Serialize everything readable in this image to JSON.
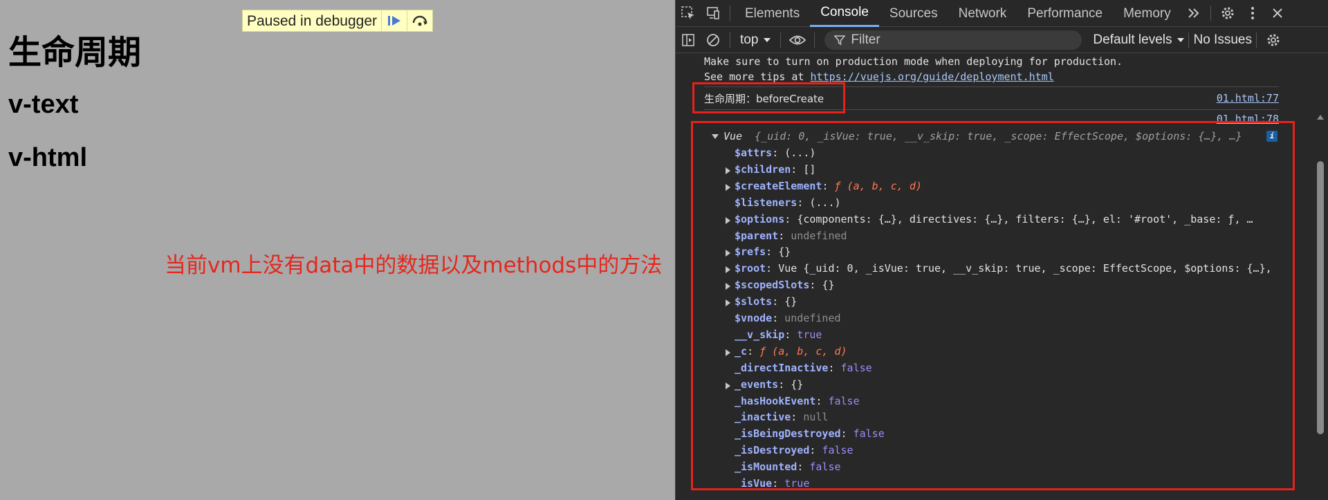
{
  "page": {
    "heading1": "生命周期",
    "heading2": "v-text",
    "heading3": "v-html",
    "debugger_banner": "Paused in debugger",
    "annotation": "当前vm上没有data中的数据以及methods中的方法"
  },
  "devtools": {
    "tabs": [
      "Elements",
      "Console",
      "Sources",
      "Network",
      "Performance",
      "Memory"
    ],
    "active_tab": "Console",
    "toolbar": {
      "context": "top",
      "filter_placeholder": "Filter",
      "levels": "Default levels",
      "issues": "No Issues"
    },
    "console": {
      "tip_line1": "Make sure to turn on production mode when deploying for production.",
      "tip_line2_prefix": "See more tips at ",
      "tip_link": "https://vuejs.org/guide/deployment.html",
      "log_text": "生命周期：beforeCreate",
      "log_source": "01.html:77",
      "log2_source": "01.html:78",
      "vue_summary_name": "Vue",
      "vue_summary": "{_uid: 0, _isVue: true, __v_skip: true, _scope: EffectScope, $options: {…}, …}",
      "props": [
        {
          "name": "$attrs",
          "value": "(...)",
          "kind": "val",
          "expandable": false
        },
        {
          "name": "$children",
          "value": "[]",
          "kind": "val",
          "expandable": true
        },
        {
          "name": "$createElement",
          "value": "ƒ (a, b, c, d)",
          "kind": "fn",
          "expandable": true
        },
        {
          "name": "$listeners",
          "value": "(...)",
          "kind": "val",
          "expandable": false
        },
        {
          "name": "$options",
          "value": "{components: {…}, directives: {…}, filters: {…}, el: '#root', _base: ƒ, …",
          "kind": "val",
          "expandable": true
        },
        {
          "name": "$parent",
          "value": "undefined",
          "kind": "null",
          "expandable": false
        },
        {
          "name": "$refs",
          "value": "{}",
          "kind": "val",
          "expandable": true
        },
        {
          "name": "$root",
          "value": "Vue  {_uid: 0, _isVue: true, __v_skip: true, _scope: EffectScope, $options: {…},",
          "kind": "val",
          "expandable": true
        },
        {
          "name": "$scopedSlots",
          "value": "{}",
          "kind": "val",
          "expandable": true
        },
        {
          "name": "$slots",
          "value": "{}",
          "kind": "val",
          "expandable": true
        },
        {
          "name": "$vnode",
          "value": "undefined",
          "kind": "null",
          "expandable": false
        },
        {
          "name": "__v_skip",
          "value": "true",
          "kind": "bool",
          "expandable": false
        },
        {
          "name": "_c",
          "value": "ƒ (a, b, c, d)",
          "kind": "fn",
          "expandable": true
        },
        {
          "name": "_directInactive",
          "value": "false",
          "kind": "bool",
          "expandable": false
        },
        {
          "name": "_events",
          "value": "{}",
          "kind": "val",
          "expandable": true
        },
        {
          "name": "_hasHookEvent",
          "value": "false",
          "kind": "bool",
          "expandable": false
        },
        {
          "name": "_inactive",
          "value": "null",
          "kind": "null",
          "expandable": false
        },
        {
          "name": "_isBeingDestroyed",
          "value": "false",
          "kind": "bool",
          "expandable": false
        },
        {
          "name": "_isDestroyed",
          "value": "false",
          "kind": "bool",
          "expandable": false
        },
        {
          "name": "_isMounted",
          "value": "false",
          "kind": "bool",
          "expandable": false
        },
        {
          "name": "_isVue",
          "value": "true",
          "kind": "bool",
          "expandable": false
        }
      ]
    }
  }
}
